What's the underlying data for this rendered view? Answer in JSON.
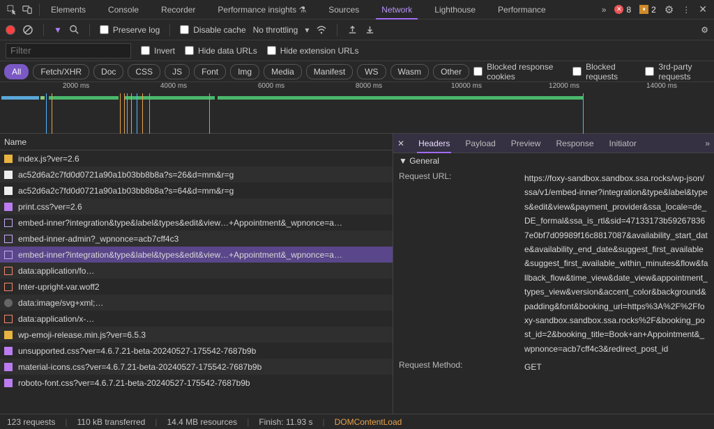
{
  "top_tabs": {
    "items": [
      "Elements",
      "Console",
      "Recorder",
      "Performance insights",
      "Sources",
      "Network",
      "Lighthouse",
      "Performance"
    ],
    "active_index": 5,
    "errors": "8",
    "warnings": "2"
  },
  "toolbar": {
    "preserve_log": "Preserve log",
    "disable_cache": "Disable cache",
    "throttling": "No throttling"
  },
  "filter_row": {
    "filter_placeholder": "Filter",
    "invert": "Invert",
    "hide_data": "Hide data URLs",
    "hide_ext": "Hide extension URLs"
  },
  "chips": {
    "items": [
      "All",
      "Fetch/XHR",
      "Doc",
      "CSS",
      "JS",
      "Font",
      "Img",
      "Media",
      "Manifest",
      "WS",
      "Wasm",
      "Other"
    ],
    "active_index": 0,
    "blocked_cookies": "Blocked response cookies",
    "blocked_req": "Blocked requests",
    "third_party": "3rd-party requests"
  },
  "timeline": {
    "ticks": [
      "2000 ms",
      "4000 ms",
      "6000 ms",
      "8000 ms",
      "10000 ms",
      "12000 ms",
      "14000 ms"
    ]
  },
  "columns": {
    "name": "Name"
  },
  "requests": [
    {
      "icon": "js",
      "name": "index.js?ver=2.6"
    },
    {
      "icon": "doc",
      "name": "ac52d6a2c7fd0d0721a90a1b03bb8b8a?s=26&d=mm&r=g"
    },
    {
      "icon": "doc",
      "name": "ac52d6a2c7fd0d0721a90a1b03bb8b8a?s=64&d=mm&r=g"
    },
    {
      "icon": "css",
      "name": "print.css?ver=2.6"
    },
    {
      "icon": "xhr",
      "name": "embed-inner?integration&type&label&types&edit&view…+Appointment&_wpnonce=a…"
    },
    {
      "icon": "xhr",
      "name": "embed-inner-admin?_wpnonce=acb7cff4c3"
    },
    {
      "icon": "xhr",
      "name": "embed-inner?integration&type&label&types&edit&view…+Appointment&_wpnonce=a…",
      "selected": true
    },
    {
      "icon": "font",
      "name": "data:application/fo…"
    },
    {
      "icon": "font",
      "name": "Inter-upright-var.woff2"
    },
    {
      "icon": "svg",
      "name": "data:image/svg+xml;…"
    },
    {
      "icon": "font",
      "name": "data:application/x-…"
    },
    {
      "icon": "js",
      "name": "wp-emoji-release.min.js?ver=6.5.3"
    },
    {
      "icon": "css",
      "name": "unsupported.css?ver=4.6.7.21-beta-20240527-175542-7687b9b"
    },
    {
      "icon": "css",
      "name": "material-icons.css?ver=4.6.7.21-beta-20240527-175542-7687b9b"
    },
    {
      "icon": "css",
      "name": "roboto-font.css?ver=4.6.7.21-beta-20240527-175542-7687b9b"
    }
  ],
  "detail_tabs": {
    "items": [
      "Headers",
      "Payload",
      "Preview",
      "Response",
      "Initiator"
    ],
    "active_index": 0
  },
  "detail": {
    "general_label": "General",
    "request_url_label": "Request URL:",
    "request_url_value": "https://foxy-sandbox.sandbox.ssa.rocks/wp-json/ssa/v1/embed-inner?integration&type&label&types&edit&view&payment_provider&ssa_locale=de_DE_formal&ssa_is_rtl&sid=47133173b592678367e0bf7d09989f16c8817087&availability_start_date&availability_end_date&suggest_first_available&suggest_first_available_within_minutes&flow&fallback_flow&time_view&date_view&appointment_types_view&version&accent_color&background&padding&font&booking_url=https%3A%2F%2Ffoxy-sandbox.sandbox.ssa.rocks%2F&booking_post_id=2&booking_title=Book+an+Appointment&_wpnonce=acb7cff4c3&redirect_post_id",
    "request_method_label": "Request Method:",
    "request_method_value": "GET"
  },
  "status": {
    "requests": "123 requests",
    "transferred": "110 kB transferred",
    "resources": "14.4 MB resources",
    "finish": "Finish: 11.93 s",
    "dom": "DOMContentLoad"
  }
}
